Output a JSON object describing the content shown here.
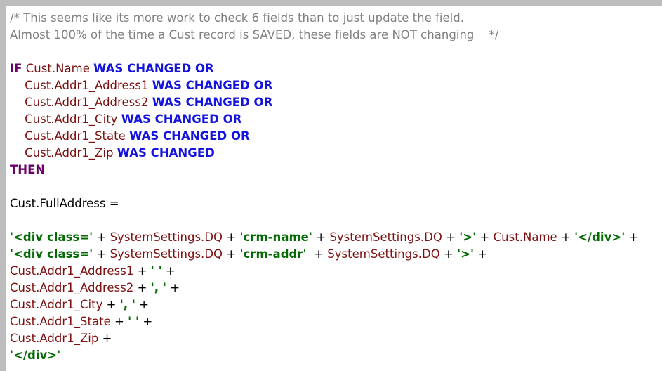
{
  "editor": {
    "title": "Code Listing",
    "language": "FileMaker Calculation",
    "colors": {
      "background": "#ffffff",
      "chrome": "#bdbdbd",
      "comment": "#808080",
      "keyword": "#6a006a",
      "operator_keyword": "#1414dd",
      "identifier": "#7d1111",
      "string": "#046a04",
      "plain": "#000000"
    }
  },
  "code": {
    "lines": [
      {
        "id": "line-1",
        "tokens": [
          {
            "kind": "comment",
            "text": "/* This seems like its more work to check 6 fields than to just update the field."
          }
        ]
      },
      {
        "id": "line-2",
        "tokens": [
          {
            "kind": "comment",
            "text": "Almost 100% of the time a Cust record is SAVED, these fields are NOT changing    */"
          }
        ]
      },
      {
        "id": "line-3",
        "tokens": []
      },
      {
        "id": "line-4",
        "tokens": [
          {
            "kind": "keyword",
            "text": "IF"
          },
          {
            "kind": "plain",
            "text": " "
          },
          {
            "kind": "ident",
            "text": "Cust.Name"
          },
          {
            "kind": "plain",
            "text": " "
          },
          {
            "kind": "op-kw",
            "text": "WAS CHANGED OR"
          }
        ]
      },
      {
        "id": "line-5",
        "tokens": [
          {
            "kind": "plain",
            "text": "    "
          },
          {
            "kind": "ident",
            "text": "Cust.Addr1_Address1"
          },
          {
            "kind": "plain",
            "text": " "
          },
          {
            "kind": "op-kw",
            "text": "WAS CHANGED OR"
          }
        ]
      },
      {
        "id": "line-6",
        "tokens": [
          {
            "kind": "plain",
            "text": "    "
          },
          {
            "kind": "ident",
            "text": "Cust.Addr1_Address2"
          },
          {
            "kind": "plain",
            "text": " "
          },
          {
            "kind": "op-kw",
            "text": "WAS CHANGED OR"
          }
        ]
      },
      {
        "id": "line-7",
        "tokens": [
          {
            "kind": "plain",
            "text": "    "
          },
          {
            "kind": "ident",
            "text": "Cust.Addr1_City"
          },
          {
            "kind": "plain",
            "text": " "
          },
          {
            "kind": "op-kw",
            "text": "WAS CHANGED OR"
          }
        ]
      },
      {
        "id": "line-8",
        "tokens": [
          {
            "kind": "plain",
            "text": "    "
          },
          {
            "kind": "ident",
            "text": "Cust.Addr1_State"
          },
          {
            "kind": "plain",
            "text": " "
          },
          {
            "kind": "op-kw",
            "text": "WAS CHANGED OR"
          }
        ]
      },
      {
        "id": "line-9",
        "tokens": [
          {
            "kind": "plain",
            "text": "    "
          },
          {
            "kind": "ident",
            "text": "Cust.Addr1_Zip"
          },
          {
            "kind": "plain",
            "text": " "
          },
          {
            "kind": "op-kw",
            "text": "WAS CHANGED"
          }
        ]
      },
      {
        "id": "line-10",
        "tokens": [
          {
            "kind": "keyword",
            "text": "THEN"
          }
        ]
      },
      {
        "id": "line-11",
        "tokens": []
      },
      {
        "id": "line-12",
        "tokens": [
          {
            "kind": "plain",
            "text": "Cust.FullAddress ="
          }
        ]
      },
      {
        "id": "line-13",
        "tokens": []
      },
      {
        "id": "line-14",
        "tokens": [
          {
            "kind": "string",
            "text": "'<div class='"
          },
          {
            "kind": "plain",
            "text": " + "
          },
          {
            "kind": "ident",
            "text": "SystemSettings.DQ"
          },
          {
            "kind": "plain",
            "text": " + "
          },
          {
            "kind": "string",
            "text": "'crm-name'"
          },
          {
            "kind": "plain",
            "text": " + "
          },
          {
            "kind": "ident",
            "text": "SystemSettings.DQ"
          },
          {
            "kind": "plain",
            "text": " + "
          },
          {
            "kind": "string",
            "text": "'>'"
          },
          {
            "kind": "plain",
            "text": " + "
          },
          {
            "kind": "ident",
            "text": "Cust.Name"
          },
          {
            "kind": "plain",
            "text": " + "
          },
          {
            "kind": "string",
            "text": "'</div>'"
          },
          {
            "kind": "plain",
            "text": " +"
          }
        ]
      },
      {
        "id": "line-15",
        "tokens": [
          {
            "kind": "string",
            "text": "'<div class='"
          },
          {
            "kind": "plain",
            "text": " + "
          },
          {
            "kind": "ident",
            "text": "SystemSettings.DQ"
          },
          {
            "kind": "plain",
            "text": " + "
          },
          {
            "kind": "string",
            "text": "'crm-addr'"
          },
          {
            "kind": "plain",
            "text": "  + "
          },
          {
            "kind": "ident",
            "text": "SystemSettings.DQ"
          },
          {
            "kind": "plain",
            "text": " + "
          },
          {
            "kind": "string",
            "text": "'>'"
          },
          {
            "kind": "plain",
            "text": " +"
          }
        ]
      },
      {
        "id": "line-16",
        "tokens": [
          {
            "kind": "ident",
            "text": "Cust.Addr1_Address1"
          },
          {
            "kind": "plain",
            "text": " + "
          },
          {
            "kind": "string",
            "text": "' '"
          },
          {
            "kind": "plain",
            "text": " +"
          }
        ]
      },
      {
        "id": "line-17",
        "tokens": [
          {
            "kind": "ident",
            "text": "Cust.Addr1_Address2"
          },
          {
            "kind": "plain",
            "text": " + "
          },
          {
            "kind": "string",
            "text": "', '"
          },
          {
            "kind": "plain",
            "text": " +"
          }
        ]
      },
      {
        "id": "line-18",
        "tokens": [
          {
            "kind": "ident",
            "text": "Cust.Addr1_City"
          },
          {
            "kind": "plain",
            "text": " + "
          },
          {
            "kind": "string",
            "text": "', '"
          },
          {
            "kind": "plain",
            "text": " +"
          }
        ]
      },
      {
        "id": "line-19",
        "tokens": [
          {
            "kind": "ident",
            "text": "Cust.Addr1_State"
          },
          {
            "kind": "plain",
            "text": " + "
          },
          {
            "kind": "string",
            "text": "' '"
          },
          {
            "kind": "plain",
            "text": " +"
          }
        ]
      },
      {
        "id": "line-20",
        "tokens": [
          {
            "kind": "ident",
            "text": "Cust.Addr1_Zip"
          },
          {
            "kind": "plain",
            "text": " +"
          }
        ]
      },
      {
        "id": "line-21",
        "tokens": [
          {
            "kind": "string",
            "text": "'</div>'"
          }
        ]
      }
    ]
  }
}
